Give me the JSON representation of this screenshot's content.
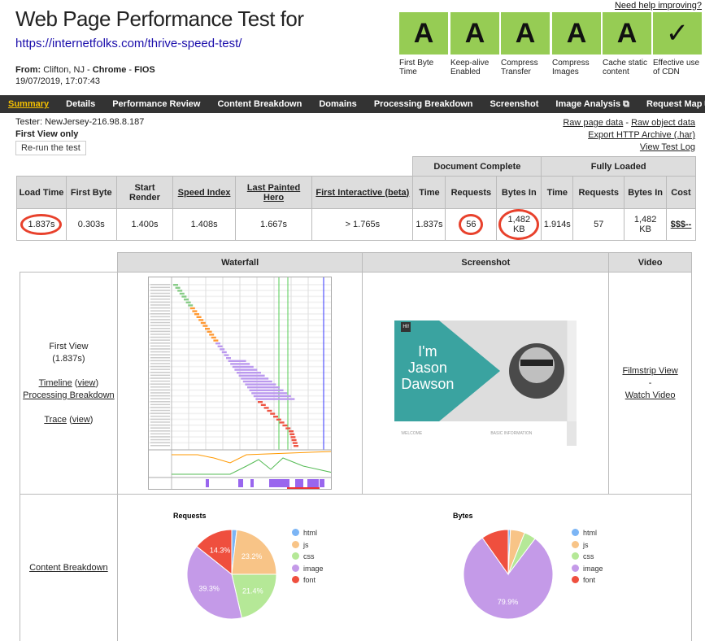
{
  "header": {
    "title": "Web Page Performance Test for",
    "url": "https://internetfolks.com/thrive-speed-test/",
    "from_label": "From:",
    "from_location": "Clifton, NJ - ",
    "browser": "Chrome",
    "sep": " - ",
    "connection": "FIOS",
    "date": "19/07/2019, 17:07:43",
    "help_link": "Need help improving?"
  },
  "grades": [
    {
      "grade": "A",
      "label": "First Byte Time"
    },
    {
      "grade": "A",
      "label": "Keep-alive Enabled"
    },
    {
      "grade": "A",
      "label": "Compress Transfer"
    },
    {
      "grade": "A",
      "label": "Compress Images"
    },
    {
      "grade": "A",
      "label": "Cache static content"
    },
    {
      "grade": "✓",
      "label": "Effective use of CDN"
    }
  ],
  "grade_color": "#96cc54",
  "nav": [
    {
      "label": "Summary",
      "active": true
    },
    {
      "label": "Details"
    },
    {
      "label": "Performance Review"
    },
    {
      "label": "Content Breakdown"
    },
    {
      "label": "Domains"
    },
    {
      "label": "Processing Breakdown"
    },
    {
      "label": "Screenshot"
    },
    {
      "label": "Image Analysis ⧉"
    },
    {
      "label": "Request Map ⧉"
    }
  ],
  "info": {
    "tester": "Tester: NewJersey-216.98.8.187",
    "first_view_only": "First View only",
    "rerun": "Re-run the test",
    "raw_page": "Raw page data",
    "dash": " - ",
    "raw_object": "Raw object data",
    "export_har": "Export HTTP Archive (.har)",
    "view_log": "View Test Log"
  },
  "results": {
    "group_headers": [
      "Document Complete",
      "Fully Loaded"
    ],
    "headers": [
      "Load Time",
      "First Byte",
      "Start Render",
      "Speed Index",
      "Last Painted Hero",
      "First Interactive (beta)",
      "Time",
      "Requests",
      "Bytes In",
      "Time",
      "Requests",
      "Bytes In",
      "Cost"
    ],
    "values": [
      "1.837s",
      "0.303s",
      "1.400s",
      "1.408s",
      "1.667s",
      "> 1.765s",
      "1.837s",
      "56",
      "1,482 KB",
      "1.914s",
      "57",
      "1,482 KB",
      "$$$--"
    ],
    "highlight_color": "#e8412c"
  },
  "views": {
    "headers": [
      "Waterfall",
      "Screenshot",
      "Video"
    ],
    "first_view": "First View",
    "first_view_time": "(1.837s)",
    "timeline": "Timeline",
    "view": "view",
    "processing": "Processing Breakdown",
    "trace": "Trace",
    "filmstrip": "Filmstrip View",
    "dash": "-",
    "watch_video": "Watch Video",
    "screenshot": {
      "badge": "HI!",
      "line1": "I'm",
      "line2": "Jason",
      "line3": "Dawson",
      "welcome": "WELCOME",
      "basic": "BASIC INFORMATION"
    },
    "content_breakdown": "Content Breakdown"
  },
  "chart_data": [
    {
      "type": "pie",
      "title": "Requests",
      "categories": [
        "html",
        "js",
        "css",
        "image",
        "font"
      ],
      "values": [
        1.8,
        23.2,
        21.4,
        39.3,
        14.3
      ],
      "colors": [
        "#7cb5f5",
        "#f8c487",
        "#b5e897",
        "#c49ae8",
        "#ef4f3e"
      ],
      "data_labels": [
        "",
        "23.2%",
        "21.4%",
        "39.3%",
        "14.3%"
      ],
      "legend": "right"
    },
    {
      "type": "pie",
      "title": "Bytes",
      "categories": [
        "html",
        "js",
        "css",
        "image",
        "font"
      ],
      "values": [
        0.8,
        5.2,
        4.3,
        79.9,
        9.8
      ],
      "colors": [
        "#7cb5f5",
        "#f8c487",
        "#b5e897",
        "#c49ae8",
        "#ef4f3e"
      ],
      "data_labels": [
        "",
        "",
        "",
        "79.9%",
        ""
      ],
      "legend": "right"
    }
  ]
}
